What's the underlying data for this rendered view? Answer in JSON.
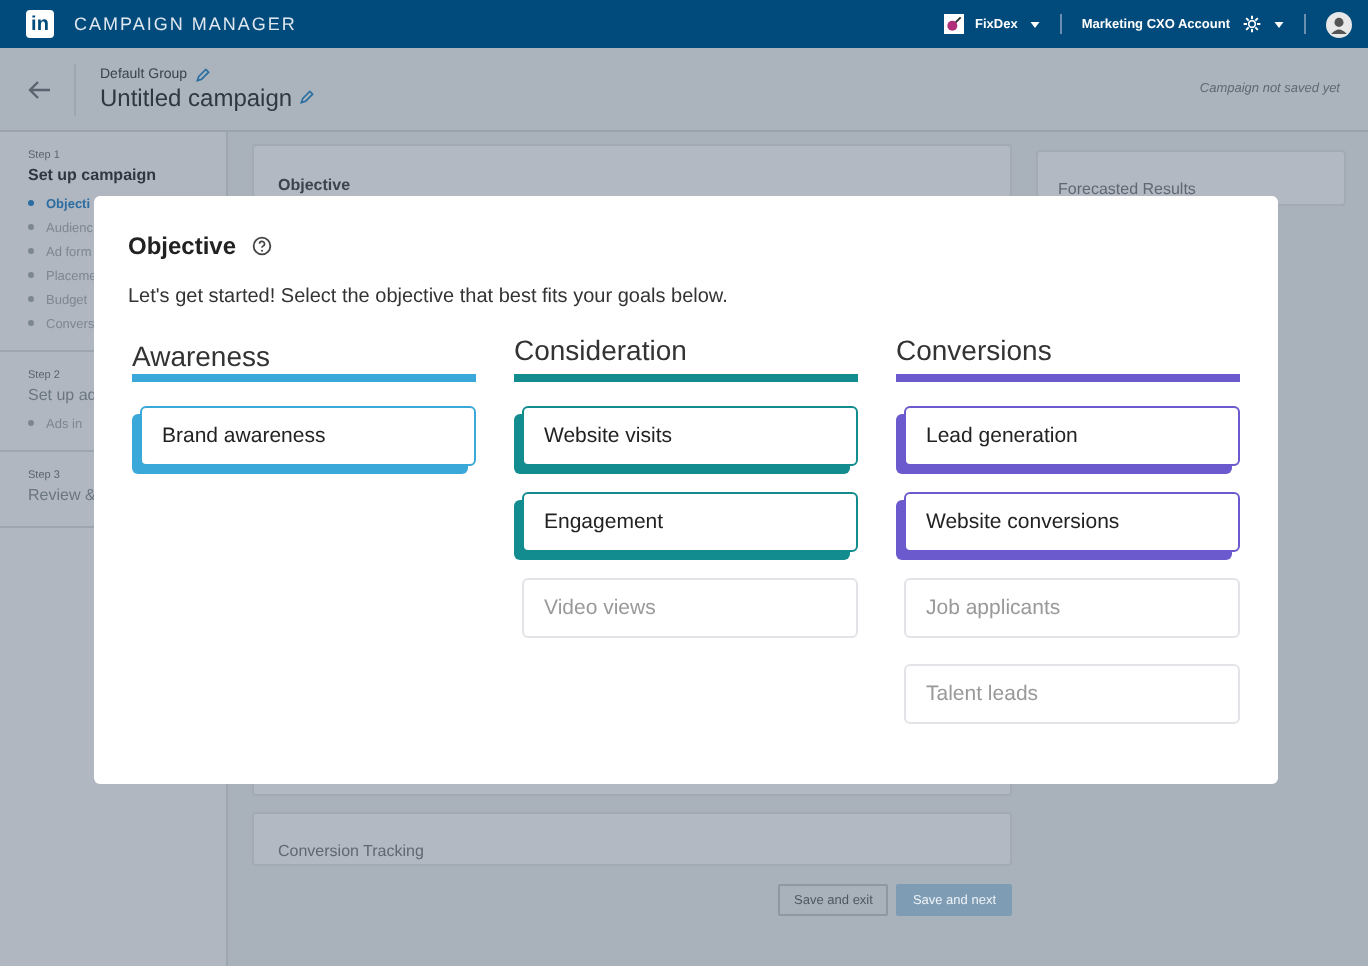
{
  "header": {
    "logo": "in",
    "title": "CAMPAIGN MANAGER",
    "company": "FixDex",
    "account": "Marketing CXO Account"
  },
  "campaign": {
    "group": "Default Group",
    "name": "Untitled campaign",
    "save_status": "Campaign not saved yet"
  },
  "sidebar": {
    "steps": [
      {
        "step": "Step 1",
        "title": "Set up campaign",
        "items": [
          {
            "label": "Objecti",
            "selected": true
          },
          {
            "label": "Audienc",
            "selected": false
          },
          {
            "label": "Ad form",
            "selected": false
          },
          {
            "label": "Placeme",
            "selected": false
          },
          {
            "label": "Budget",
            "selected": false
          },
          {
            "label": "Convers",
            "selected": false
          }
        ]
      },
      {
        "step": "Step 2",
        "title": "Set up ad",
        "items": [
          {
            "label": "Ads in",
            "selected": false
          }
        ]
      },
      {
        "step": "Step 3",
        "title": "Review &"
      }
    ]
  },
  "main": {
    "objective_card_title": "Objective",
    "conversion_card_title": "Conversion Tracking",
    "forecast_title": "Forecasted Results",
    "buttons": [
      "Save and exit",
      "Save and next"
    ]
  },
  "modal": {
    "title": "Objective",
    "intro": "Let's get started! Select the objective that best fits your goals below.",
    "columns": [
      {
        "heading": "Awareness",
        "color": "#3aa9d9",
        "options": [
          {
            "label": "Brand awareness",
            "disabled": false
          }
        ]
      },
      {
        "heading": "Consideration",
        "color": "#138c8f",
        "options": [
          {
            "label": "Website visits",
            "disabled": false
          },
          {
            "label": "Engagement",
            "disabled": false
          },
          {
            "label": "Video views",
            "disabled": true
          }
        ]
      },
      {
        "heading": "Conversions",
        "color": "#6a5acd",
        "options": [
          {
            "label": "Lead generation",
            "disabled": false
          },
          {
            "label": "Website conversions",
            "disabled": false
          },
          {
            "label": "Job applicants",
            "disabled": true
          },
          {
            "label": "Talent leads",
            "disabled": true
          }
        ]
      }
    ]
  }
}
